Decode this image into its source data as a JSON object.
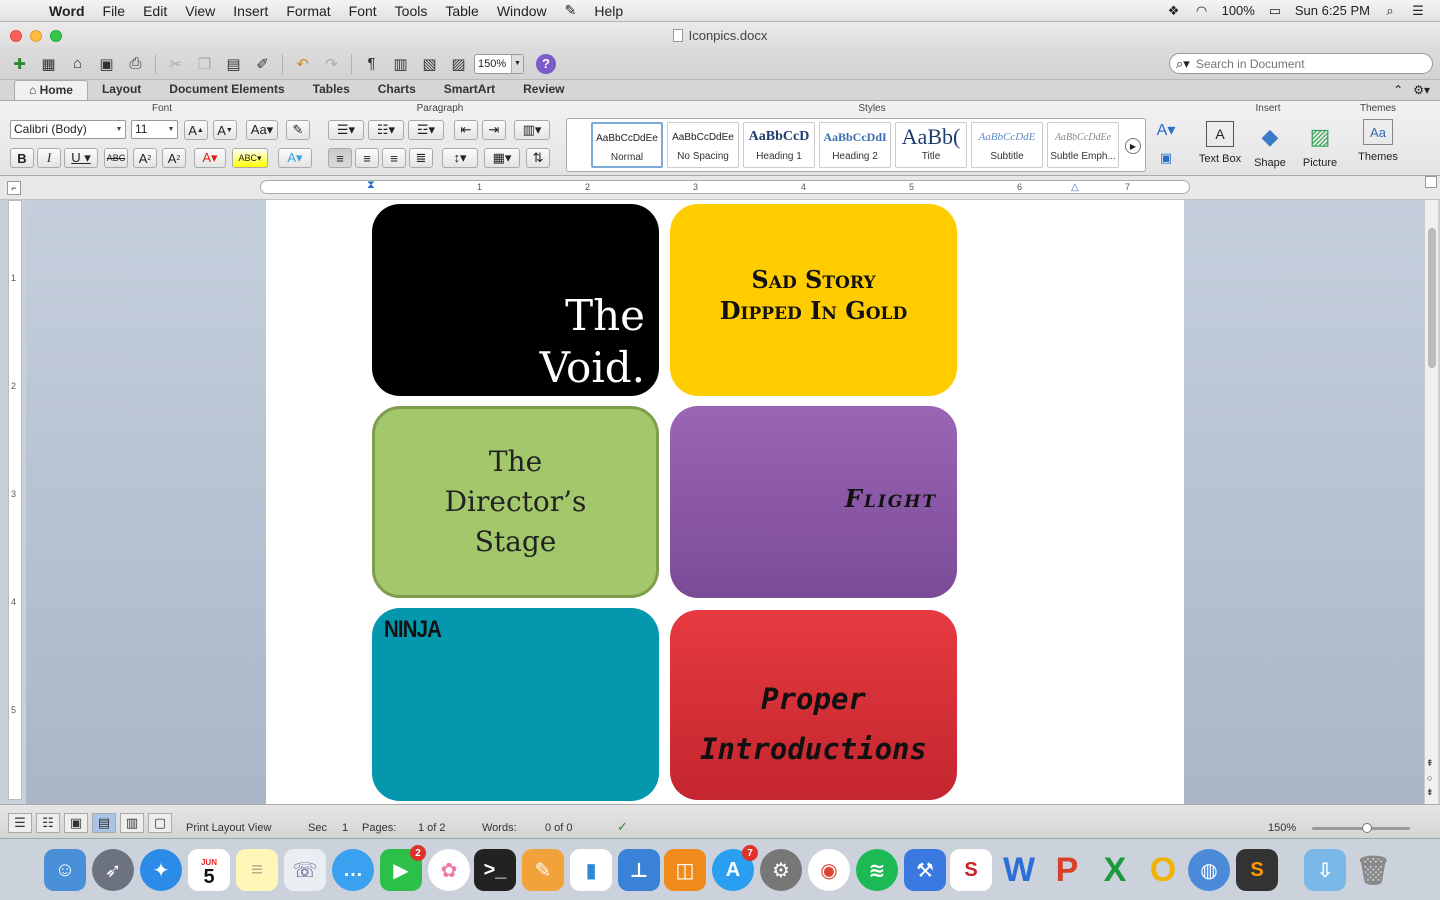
{
  "menubar": {
    "apple_icon": "apple-icon",
    "items": [
      "Word",
      "File",
      "Edit",
      "View",
      "Insert",
      "Format",
      "Font",
      "Tools",
      "Table",
      "Window",
      "Help"
    ],
    "battery": "100%",
    "clock": "Sun 6:25 PM"
  },
  "window": {
    "title": "Iconpics.docx"
  },
  "toolbar": {
    "zoom": "150%",
    "help": "?",
    "search_placeholder": "Search in Document"
  },
  "ribbon": {
    "tabs": [
      "Home",
      "Layout",
      "Document Elements",
      "Tables",
      "Charts",
      "SmartArt",
      "Review"
    ],
    "active_tab": "Home",
    "groups": {
      "font": "Font",
      "paragraph": "Paragraph",
      "styles": "Styles",
      "insert": "Insert",
      "themes": "Themes"
    },
    "font_name": "Calibri (Body)",
    "font_size": "11",
    "styles": [
      {
        "preview": "AaBbCcDdEe",
        "label": "Normal"
      },
      {
        "preview": "AaBbCcDdEe",
        "label": "No Spacing"
      },
      {
        "preview": "AaBbCcD",
        "label": "Heading 1"
      },
      {
        "preview": "AaBbCcDdI",
        "label": "Heading 2"
      },
      {
        "preview": "AaBb(",
        "label": "Title"
      },
      {
        "preview": "AaBbCcDdE",
        "label": "Subtitle"
      },
      {
        "preview": "AaBbCcDdEe",
        "label": "Subtle Emph..."
      }
    ],
    "insert_buttons": [
      "Text Box",
      "Shape",
      "Picture"
    ],
    "themes_button": "Themes"
  },
  "ruler": {
    "h_numbers": [
      "1",
      "2",
      "3",
      "4",
      "5",
      "6",
      "7"
    ],
    "v_numbers": [
      "1",
      "2",
      "3",
      "4",
      "5"
    ]
  },
  "cards": [
    {
      "text": "The Void.",
      "bg": "#000000",
      "fg": "#ffffff"
    },
    {
      "text": "Sad Story Dipped In Gold",
      "bg": "#ffcc00",
      "fg": "#111111"
    },
    {
      "text": "The Director’s Stage",
      "bg": "#a2c86b",
      "fg": "#222222"
    },
    {
      "text": "Flight",
      "bg": "#8e5aa8",
      "fg": "#111111"
    },
    {
      "text": "NINJA",
      "bg": "#0597ad",
      "fg": "#111111"
    },
    {
      "text": "Proper Introductions",
      "bg": "#d8303a",
      "fg": "#111111"
    }
  ],
  "statusbar": {
    "view_label": "Print Layout View",
    "sec_label": "Sec",
    "sec_value": "1",
    "pages_label": "Pages:",
    "pages_value": "1 of 2",
    "words_label": "Words:",
    "words_value": "0 of 0",
    "zoom": "150%"
  },
  "dock": {
    "calendar_month": "JUN",
    "calendar_day": "5",
    "facetime_badge": "2",
    "appstore_badge": "7"
  }
}
